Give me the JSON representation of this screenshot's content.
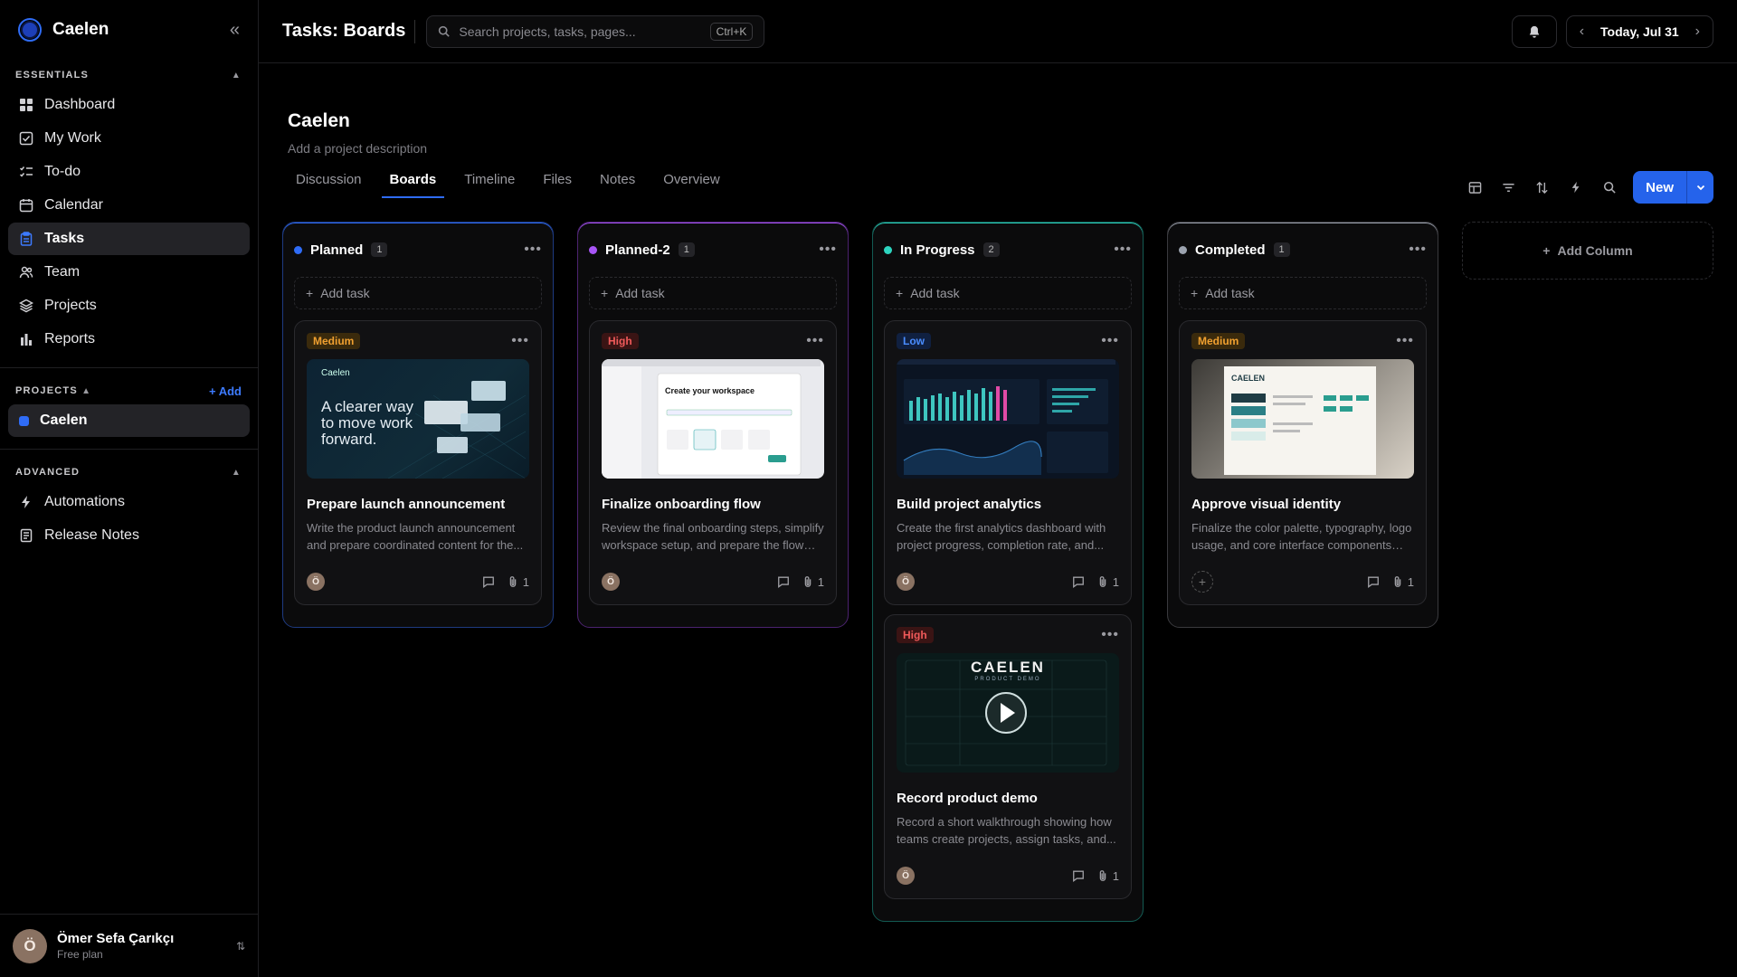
{
  "app": {
    "brand": "Caelen"
  },
  "sidebar": {
    "essentials_label": "ESSENTIALS",
    "items": [
      {
        "label": "Dashboard",
        "icon": "grid-icon"
      },
      {
        "label": "My Work",
        "icon": "checkbox-icon"
      },
      {
        "label": "To-do",
        "icon": "list-check-icon"
      },
      {
        "label": "Calendar",
        "icon": "calendar-icon"
      },
      {
        "label": "Tasks",
        "icon": "clipboard-icon",
        "active": true
      },
      {
        "label": "Team",
        "icon": "users-icon"
      },
      {
        "label": "Projects",
        "icon": "layers-icon"
      },
      {
        "label": "Reports",
        "icon": "bar-chart-icon"
      }
    ],
    "projects_label": "PROJECTS",
    "add_label": "+ Add",
    "projects": [
      {
        "label": "Caelen",
        "color": "#2f6cf6"
      }
    ],
    "advanced_label": "ADVANCED",
    "advanced_items": [
      {
        "label": "Automations",
        "icon": "bolt-icon"
      },
      {
        "label": "Release Notes",
        "icon": "document-icon"
      }
    ],
    "user": {
      "name": "Ömer Sefa Çarıkçı",
      "plan": "Free plan",
      "initial": "Ö"
    }
  },
  "topbar": {
    "title": "Tasks: Boards",
    "search_placeholder": "Search projects, tasks, pages...",
    "shortcut": "Ctrl+K",
    "date": "Today, Jul 31"
  },
  "project": {
    "name": "Caelen",
    "description": "Add a project description",
    "tabs": [
      "Discussion",
      "Boards",
      "Timeline",
      "Files",
      "Notes",
      "Overview"
    ],
    "active_tab": "Boards",
    "new_label": "New"
  },
  "board": {
    "add_task_label": "Add task",
    "add_column_label": "Add Column",
    "columns": [
      {
        "title": "Planned",
        "count": "1",
        "color": "#2f6cf6",
        "border": "#1e3a80",
        "cards": [
          {
            "priority": "Medium",
            "title": "Prepare launch announcement",
            "desc": "Write the product launch announcement and prepare coordinated content for the...",
            "attachments": "1",
            "thumb_text": "A clearer way to move work forward.",
            "thumb_mark": "Caelen",
            "avatar": "Ö"
          }
        ]
      },
      {
        "title": "Planned-2",
        "count": "1",
        "color": "#a855f7",
        "border": "#4c2370",
        "cards": [
          {
            "priority": "High",
            "title": "Finalize onboarding flow",
            "desc": "Review the final onboarding steps, simplify workspace setup, and prepare the flow fo...",
            "attachments": "1",
            "thumb_text": "Create your workspace",
            "thumb_mark": "Dashboard",
            "avatar": "Ö"
          }
        ]
      },
      {
        "title": "In Progress",
        "count": "2",
        "color": "#2dd4bf",
        "border": "#135a52",
        "cards": [
          {
            "priority": "Low",
            "title": "Build project analytics",
            "desc": "Create the first analytics dashboard with project progress, completion rate, and...",
            "attachments": "1",
            "avatar": "Ö"
          },
          {
            "priority": "High",
            "title": "Record product demo",
            "desc": "Record a short walkthrough showing how teams create projects, assign tasks, and...",
            "attachments": "1",
            "thumb_text": "CAELEN",
            "thumb_mark": "PRODUCT DEMO",
            "avatar": "Ö"
          }
        ]
      },
      {
        "title": "Completed",
        "count": "1",
        "color": "#9ca3af",
        "border": "#3a3a3e",
        "cards": [
          {
            "priority": "Medium",
            "title": "Approve visual identity",
            "desc": "Finalize the color palette, typography, logo usage, and core interface components for...",
            "attachments": "1",
            "thumb_text": "CAELEN"
          }
        ]
      }
    ]
  }
}
